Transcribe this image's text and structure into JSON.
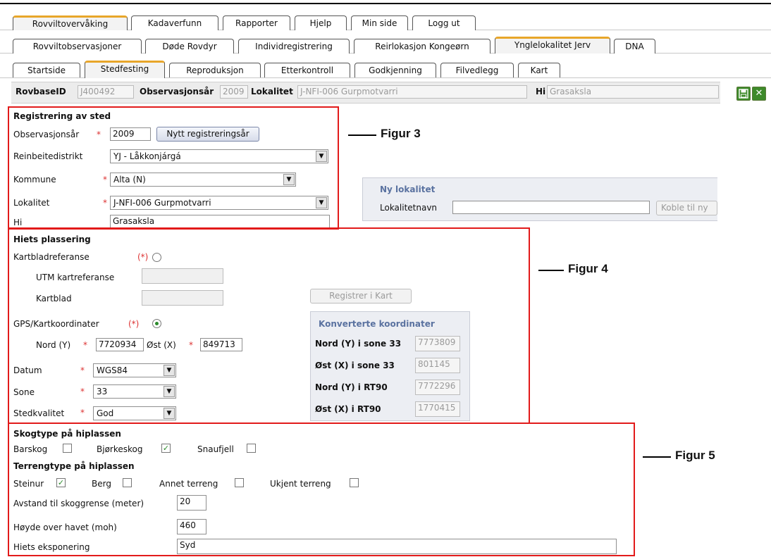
{
  "tabs_row1": [
    "Rovviltovervåking",
    "Kadaverfunn",
    "Rapporter",
    "Hjelp",
    "Min side",
    "Logg ut"
  ],
  "tabs_row2": [
    "Rovviltobservasjoner",
    "Døde Rovdyr",
    "Individregistrering",
    "Reirlokasjon Kongeørn",
    "Ynglelokalitet Jerv",
    "DNA"
  ],
  "tabs_row3": [
    "Startside",
    "Stedfesting",
    "Reproduksjon",
    "Etterkontroll",
    "Godkjenning",
    "Filvedlegg",
    "Kart"
  ],
  "idbar": {
    "rovbase_label": "RovbaseID",
    "rovbase_value": "J400492",
    "obsyear_label": "Observasjonsår",
    "obsyear_value": "2009",
    "lok_label": "Lokalitet",
    "lok_value": "J-NFI-006 Gurpmotvarri",
    "hi_label": "Hi",
    "hi_value": "Grasaksla",
    "save_icon": "save-icon",
    "close_icon": "close-icon"
  },
  "sted": {
    "title": "Registrering av sted",
    "obsyear_label": "Observasjonsår",
    "obsyear_value": "2009",
    "new_year_button": "Nytt registreringsår",
    "reinbeite_label": "Reinbeitedistrikt",
    "reinbeite_value": "YJ - Låkkonjárgá",
    "kommune_label": "Kommune",
    "kommune_value": "Alta (N)",
    "lokalitet_label": "Lokalitet",
    "lokalitet_value": "J-NFI-006 Gurpmotvarri",
    "hi_label": "Hi",
    "hi_value": "Grasaksla"
  },
  "ny_lokalitet": {
    "title": "Ny lokalitet",
    "name_label": "Lokalitetnavn",
    "name_value": "",
    "button": "Koble til ny"
  },
  "plassering": {
    "title": "Hiets plassering",
    "kartblad_ref_label": "Kartbladreferanse",
    "req_paren": "(*)",
    "utm_label": "UTM kartreferanse",
    "kartblad_label": "Kartblad",
    "register_button": "Registrer i Kart",
    "gps_label": "GPS/Kartkoordinater",
    "nord_label": "Nord (Y)",
    "nord_value": "7720934",
    "ost_label": "Øst (X)",
    "ost_value": "849713",
    "datum_label": "Datum",
    "datum_value": "WGS84",
    "sone_label": "Sone",
    "sone_value": "33",
    "stedkvalitet_label": "Stedkvalitet",
    "stedkvalitet_value": "God"
  },
  "konverterte": {
    "title": "Konverterte koordinater",
    "rows": [
      {
        "label": "Nord (Y) i sone 33",
        "value": "7773809"
      },
      {
        "label": "Øst (X) i sone 33",
        "value": "801145"
      },
      {
        "label": "Nord (Y) i RT90",
        "value": "7772296"
      },
      {
        "label": "Øst (X) i RT90",
        "value": "1770415"
      }
    ]
  },
  "skog": {
    "title": "Skogtype på hiplassen",
    "barskog": "Barskog",
    "bjorkeskog": "Bjørkeskog",
    "snaufjell": "Snaufjell",
    "terreng_title": "Terrengtype på hiplassen",
    "steinur": "Steinur",
    "berg": "Berg",
    "annet": "Annet terreng",
    "ukjent": "Ukjent terreng",
    "avstand_label": "Avstand til skoggrense (meter)",
    "avstand_value": "20",
    "hoyde_label": "Høyde over havet (moh)",
    "hoyde_value": "460",
    "eksp_label": "Hiets eksponering",
    "eksp_value": "Syd",
    "check_mark": "✓"
  },
  "figures": {
    "fig3": "Figur 3",
    "fig4": "Figur 4",
    "fig5": "Figur 5"
  },
  "colors": {
    "highlight": "#e21a1a",
    "active_tab": "#e8a62a",
    "panel_title": "#5a72a0",
    "icon_green": "#3d8a2a"
  }
}
